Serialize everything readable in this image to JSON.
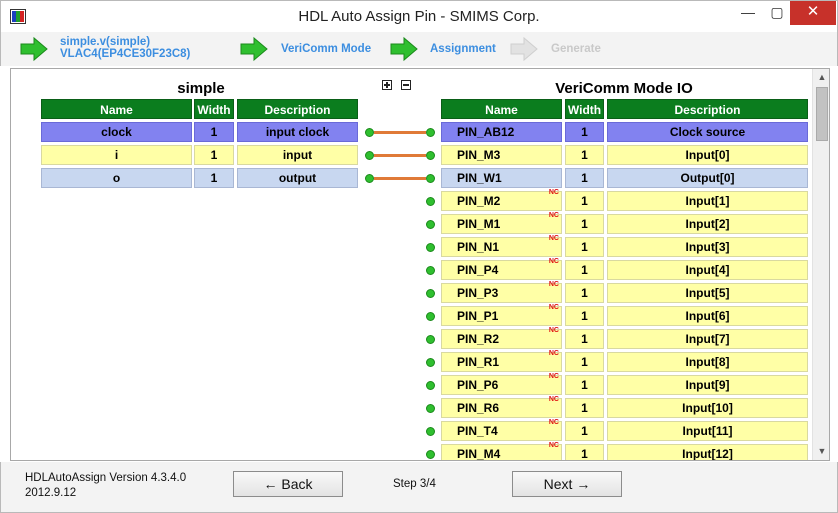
{
  "window": {
    "title": "HDL Auto Assign Pin - SMIMS Corp.",
    "minimize": "—",
    "maximize": "▢",
    "close": "✕"
  },
  "steps": [
    {
      "label_line1": "simple.v(simple)",
      "label_line2": "VLAC4(EP4CE30F23C8)",
      "state": "done"
    },
    {
      "label_line1": "VeriComm Mode",
      "label_line2": "",
      "state": "done"
    },
    {
      "label_line1": "Assignment",
      "label_line2": "",
      "state": "current"
    },
    {
      "label_line1": "Generate",
      "label_line2": "",
      "state": "disabled"
    }
  ],
  "colors": {
    "header_green": "#0b7d1e",
    "row_blue": "#8282f0",
    "row_yellow": "#ffffa6",
    "row_lightblue": "#c8d7f0",
    "wire_orange": "#e07a38",
    "dot_green": "#2fbf2f",
    "step_label_blue": "#3c8ee0",
    "close_red": "#c7312a"
  },
  "left_table": {
    "title": "simple",
    "expand_icon": "expand-all-icon",
    "collapse_icon": "collapse-all-icon",
    "headers": [
      "Name",
      "Width",
      "Description"
    ],
    "rows": [
      {
        "name": "clock",
        "width": "1",
        "description": "input clock",
        "color": "blue"
      },
      {
        "name": "i",
        "width": "1",
        "description": "input",
        "color": "yellow"
      },
      {
        "name": "o",
        "width": "1",
        "description": "output",
        "color": "lightblue"
      }
    ]
  },
  "right_table": {
    "title": "VeriComm Mode IO",
    "headers": [
      "Name",
      "Width",
      "Description"
    ],
    "rows": [
      {
        "name": "PIN_AB12",
        "width": "1",
        "description": "Clock source",
        "color": "blue",
        "nc": ""
      },
      {
        "name": "PIN_M3",
        "width": "1",
        "description": "Input[0]",
        "color": "yellow",
        "nc": ""
      },
      {
        "name": "PIN_W1",
        "width": "1",
        "description": "Output[0]",
        "color": "lightblue",
        "nc": ""
      },
      {
        "name": "PIN_M2",
        "width": "1",
        "description": "Input[1]",
        "color": "yellow",
        "nc": "NC"
      },
      {
        "name": "PIN_M1",
        "width": "1",
        "description": "Input[2]",
        "color": "yellow",
        "nc": "NC"
      },
      {
        "name": "PIN_N1",
        "width": "1",
        "description": "Input[3]",
        "color": "yellow",
        "nc": "NC"
      },
      {
        "name": "PIN_P4",
        "width": "1",
        "description": "Input[4]",
        "color": "yellow",
        "nc": "NC"
      },
      {
        "name": "PIN_P3",
        "width": "1",
        "description": "Input[5]",
        "color": "yellow",
        "nc": "NC"
      },
      {
        "name": "PIN_P1",
        "width": "1",
        "description": "Input[6]",
        "color": "yellow",
        "nc": "NC"
      },
      {
        "name": "PIN_R2",
        "width": "1",
        "description": "Input[7]",
        "color": "yellow",
        "nc": "NC"
      },
      {
        "name": "PIN_R1",
        "width": "1",
        "description": "Input[8]",
        "color": "yellow",
        "nc": "NC"
      },
      {
        "name": "PIN_P6",
        "width": "1",
        "description": "Input[9]",
        "color": "yellow",
        "nc": "NC"
      },
      {
        "name": "PIN_R6",
        "width": "1",
        "description": "Input[10]",
        "color": "yellow",
        "nc": "NC"
      },
      {
        "name": "PIN_T4",
        "width": "1",
        "description": "Input[11]",
        "color": "yellow",
        "nc": "NC"
      },
      {
        "name": "PIN_M4",
        "width": "1",
        "description": "Input[12]",
        "color": "yellow",
        "nc": "NC"
      }
    ]
  },
  "connections": [
    {
      "from_left_row": 0,
      "to_right_row": 0
    },
    {
      "from_left_row": 1,
      "to_right_row": 1
    },
    {
      "from_left_row": 2,
      "to_right_row": 2
    }
  ],
  "scrollbar": {
    "up": "▲",
    "down": "▼"
  },
  "footer": {
    "version_line1": "HDLAutoAssign Version 4.3.4.0",
    "version_line2": "2012.9.12",
    "back_label": "← Back",
    "next_label": "Next →",
    "step_text": "Step 3/4"
  }
}
